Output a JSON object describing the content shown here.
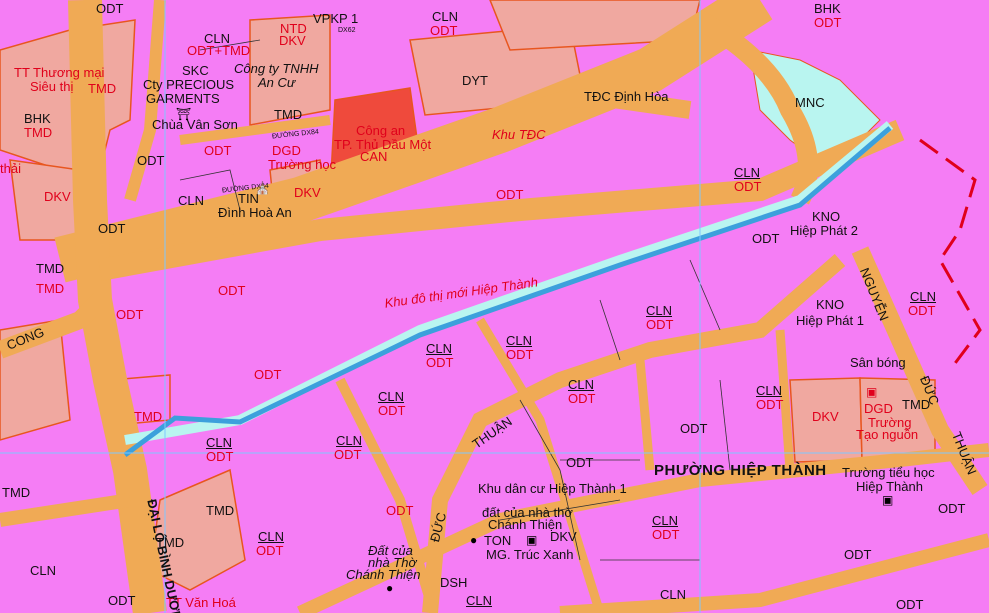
{
  "colors": {
    "residential": "#f57df5",
    "road": "#f0aa55",
    "road_edge": "#e8561f",
    "commercial": "#f0a8a0",
    "government": "#ef4a3c",
    "water": "#b9f5f0",
    "blue_line": "#3ca0dc",
    "grid": "#7ec8ff"
  },
  "labels": {
    "odt": "ODT",
    "cln": "CLN",
    "tmd": "TMD",
    "dkv": "DKV",
    "skc": "SKC",
    "bhk": "BHK",
    "dyt": "DYT",
    "can": "CAN",
    "mnc": "MNC",
    "ntd": "NTD",
    "dgd": "DGD",
    "tin": "TIN",
    "ton": "TON",
    "dsh": "DSH",
    "kno": "KNO",
    "odt_tmd": "ODT+TMD",
    "vpkp1": "VPKP 1",
    "tt_thuong_mai": "TT Thương mại",
    "sieu_thi": "Siêu thị",
    "precious": "Cty PRECIOUS",
    "garments": "GARMENTS",
    "cong_ty_an_cu": "Công ty TNHH",
    "an_cu": "An Cư",
    "chua_van_son": "Chùa Vân Sơn",
    "dgd_truong_hoc": "Trường học",
    "cong_an": "Công an",
    "tp_tdm": "TP. Thủ Dầu Một",
    "khu_tdc": "Khu TĐC",
    "tdc_dinh_hoa": "TĐC Định Hòa",
    "dinh_hoa_an": "Đình Hoà An",
    "hiep_phat_2": "Hiệp Phát 2",
    "hiep_phat_1": "Hiệp Phát 1",
    "san_bong": "Sân bóng",
    "khu_do_thi": "Khu đô thị mới Hiệp Thành",
    "nguyen": "NGUYỄN",
    "duc": "ĐỨC",
    "thuan": "THUẬN",
    "thuan2": "THUẬN",
    "duc2": "ĐỨC",
    "phuong": "PHƯỜNG HIỆP THÀNH",
    "truong_tieu_hoc": "Trường tiểu học",
    "hiep_thanh": "Hiệp Thành",
    "dgd_truong": "Trường",
    "tao_nguon": "Tạo nguồn",
    "khu_dan_cu": "Khu dân cư Hiệp Thành 1",
    "dat_nha_tho": "đất của nhà thờ",
    "chanh_thien": "Chánh Thiện",
    "dat_cua": "Đất của",
    "nha_tho": "nhà Thờ",
    "chanh_thien2": "Chánh Thiện",
    "mg_truc_xanh": "MG. Trúc Xanh",
    "cong": "CONG",
    "dai_lo": "ĐẠI LỘ BÌNH DƯƠNG",
    "tt_van_hoa": "TT Văn Hoá",
    "thai": "thải",
    "duong_dx84": "ĐƯỜNG DX84",
    "duong_dx84b": "ĐƯỜNG DX84",
    "duong_dx62": "DX62"
  }
}
